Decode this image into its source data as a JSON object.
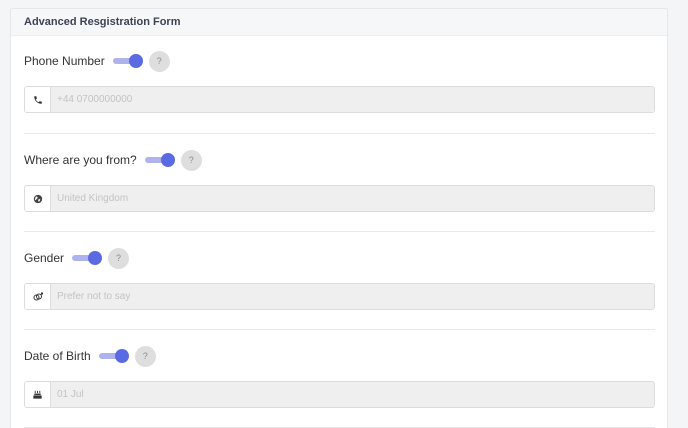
{
  "form": {
    "title": "Advanced Resgistration Form",
    "fields": [
      {
        "label": "Phone Number",
        "placeholder": "+44 0700000000",
        "icon": "phone-icon",
        "help": "?",
        "toggle_on": true
      },
      {
        "label": "Where are you from?",
        "placeholder": "United Kingdom",
        "icon": "globe-icon",
        "help": "?",
        "toggle_on": true
      },
      {
        "label": "Gender",
        "placeholder": "Prefer not to say",
        "icon": "gender-icon",
        "help": "?",
        "toggle_on": true
      },
      {
        "label": "Date of Birth",
        "placeholder": "01 Jul",
        "icon": "birthday-cake-icon",
        "help": "?",
        "toggle_on": true
      }
    ]
  },
  "colors": {
    "toggle_knob": "#5a6ae3",
    "toggle_track": "#aeb3ee",
    "input_bg": "#efefef"
  }
}
